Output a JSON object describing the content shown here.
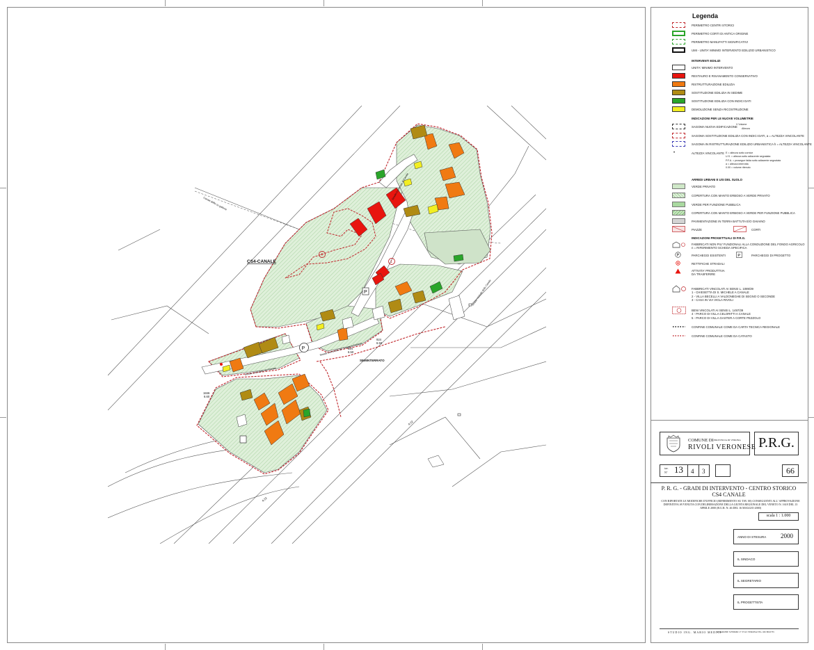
{
  "map": {
    "zone_label": "CS4-CANALE",
    "seminterrato": "SEMINTERRATO",
    "road_labels": [
      "Strada Comunale dei Tomasi",
      "Strada Comunale dei Tomasi a Trebese",
      "Strada Comunale di Canale",
      "Strada Vicinale delle Canale",
      "A 22",
      "A 22",
      "Canale Biffis su galleria"
    ],
    "quota_1": [
      "1846",
      "6.60"
    ],
    "quota_2": [
      "924",
      "6.50"
    ],
    "quota_3": [
      "924",
      "6.50"
    ],
    "markers": {
      "n4": "4",
      "n1": "1",
      "parking": "P"
    }
  },
  "legend": {
    "title": "Legenda",
    "perimeters": [
      "PERIMETRO CENTRI STORICI",
      "PERIMETRO CORTI DI ANTICA ORIGINE",
      "PERIMETRO MANUFATTI SIGNIFICATIVI",
      "UMI - UNITA' MINIMO INTERVENTO EDILIZIO URBANISTICO"
    ],
    "interventi_title": "INTERVENTI EDILIZI",
    "interventi": [
      {
        "label": "UNITA' MINIMO INTERVENTO",
        "color": "#ffffff"
      },
      {
        "label": "RESTAURO E RISANAMENTO CONSERVATIVO",
        "color": "#e8150f"
      },
      {
        "label": "RISTRUTTURAZIONE EDILIZIA",
        "color": "#f07a12"
      },
      {
        "label": "SOSTITUZIONE EDILIZIA IN SEDIME",
        "color": "#b08b14"
      },
      {
        "label": "SOSTITUZIONE EDILIZIA CON INDICI DATI",
        "color": "#2aa52a"
      },
      {
        "label": "DEMOLIZIONE SENZA RICOSTRUZIONE",
        "color": "#f2ee22"
      }
    ],
    "volumi_title": "INDICAZIONI PER LE NUOVE VOLUMETRIE",
    "volumi": [
      "SAGOMA NUOVA EDIFICAZIONE",
      "SAGOMA SOSTITUZIONE EDILIZIA CON INDICI DATI, a = ALTEZZA VINCOLANTE",
      "SAGOMA IN RISTRUTTURAZIONE EDILIZIO URBANISTICA h = ALTEZZA VINCOLANTE",
      "ALTEZZA VINCOLANTE"
    ],
    "volumi_fraction": [
      "V Volume",
      "Altezza"
    ],
    "altezza_notes": [
      "E = altezza sotto cornice",
      "U.S. = altezza sotto adiacente segnalata",
      "P.F.A. = prosegue falda sotto adiacente segnalata",
      "a = altezza interrotta",
      "0.00 = volume ritenuto"
    ],
    "arredi_title": "ARREDI URBANI E USI DEL SUOLO",
    "arredi": [
      "VERDE PRIVATO",
      "COPERTURA CON MANTO ERBOSO A VERDE PRIVATO",
      "VERDE PER FUNZIONE PUBBLICA",
      "COPERTURA CON MANTO ERBOSO A VERDE PER FUNZIONE PUBBLICA",
      "PAVIMENTAZIONE IN TERRA BATTUTA E/O GHIAINO"
    ],
    "piazze": "PIAZZE",
    "corti": "CORTI",
    "progetto_title": "INDICAZIONI PROGETTUALI DI P.R.G.",
    "progetto": [
      "FABBRICATI NON PIU' FUNZIONALI ALLA CONDUZIONE DEL FONDO AGRICOLO",
      "n = RIFERIMENTO SCHEDA SPECIFICA",
      "PARCHEGGI ESISTENTI",
      "PARCHEGGI DI PROGETTO",
      "RETTIFICHE STRADALI",
      "ATTIVITA' PRODUTTIVA",
      "DA TRASFERIRE"
    ],
    "vincoli": [
      "FABBRICATI VINCOLATI AI SENSI L. 1089/39",
      "1 - CHIESETTA DI S. MICHELE A CANALE",
      "2 - VILLA BECELLI A VALDONEGHE DI SEGNO O SECONDE",
      "3 - CASA IN VIA VIGLA RIVOLI",
      "BENI VINCOLATI AI SENSI L. 1497/39",
      "4 - PARCO DI VILLA CELORITTI A CANALE",
      "5 - PARCO DI VILLA GASTER A CORTE PEZZOLO",
      "CONFINE COMUNALE COME DA CARTA TECNICA REGIONALE",
      "CONFINE COMUNALE COME DA CATASTO"
    ]
  },
  "titleblock": {
    "comune_di": "COMUNE DI",
    "provincia": "PROVINCIA DI VERONA",
    "comune": "RIVOLI VERONESE",
    "prg": "P.R.G.",
    "tav_label": "tav.",
    "n_label": "N°",
    "tav_number": "13",
    "tav_sub1": "4",
    "tav_sub2": "3",
    "sheet": "66",
    "title_1": "P. R. G. - GRADI DI INTERVENTO - CENTRO STORICO",
    "title_2": "CS4 CANALE",
    "note": "CON RIPORTATE LE MODIFICHE D'UFFICIO (RIFERIMENTO SU TAV. 00) CONSEGUENTI ALL' APPROVAZIONE DEFINITIVA AVVENUTA CON DELIBERAZIONE DELLA GIUNTA REGIONALE DEL VENETO N. 1618 DEL 13 APRILE 2000 (B.U.R. N. 46 DEL 16 MAGGIO 2000)",
    "scale": "scala   1 : 1.000",
    "anno_label": "ANNO DI STESURA",
    "anno": "2000",
    "sindaco": "IL SINDACO",
    "segretario": "IL SEGRETARIO",
    "progettista": "IL PROGETTISTA",
    "studio": "STUDIO ING. MARIO MEDICI",
    "studio_addr": "STRADONE S.FERMO 17   37121 VERONA   TEL. 045 8010735"
  },
  "colors": {
    "green_private": "#d6ecd2",
    "restauro": "#e8150f",
    "ristrutturazione": "#f07a12",
    "sedime": "#b08b14",
    "indici": "#2aa52a",
    "demolizione": "#f2ee22",
    "perimeter": "#c0262b"
  }
}
